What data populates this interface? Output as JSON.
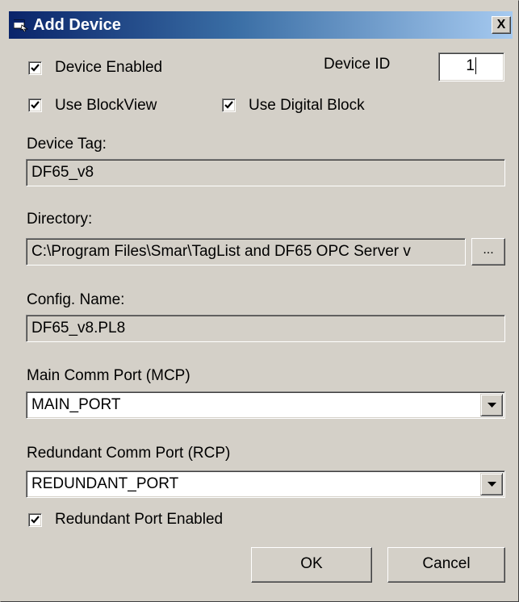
{
  "window": {
    "title": "Add Device",
    "title_icon": "app-window-icon",
    "close_icon": "close-icon",
    "close_label": "X"
  },
  "checkboxes": {
    "device_enabled": {
      "label": "Device Enabled",
      "checked": true
    },
    "use_blockview": {
      "label": "Use BlockView",
      "checked": true
    },
    "use_digital_block": {
      "label": "Use Digital Block",
      "checked": true
    },
    "redundant_port_enabled": {
      "label": "Redundant Port Enabled",
      "checked": true
    }
  },
  "device_id": {
    "label": "Device ID",
    "value": "1"
  },
  "device_tag": {
    "label": "Device Tag:",
    "value": "DF65_v8"
  },
  "directory": {
    "label": "Directory:",
    "value": "C:\\Program Files\\Smar\\TagList and DF65 OPC Server v",
    "browse_label": "..."
  },
  "config_name": {
    "label": "Config. Name:",
    "value": "DF65_v8.PL8"
  },
  "main_comm_port": {
    "label": "Main Comm Port (MCP)",
    "selected": "MAIN_PORT",
    "icon": "dropdown-arrow-icon"
  },
  "redundant_comm_port": {
    "label": "Redundant Comm Port (RCP)",
    "selected": "REDUNDANT_PORT",
    "icon": "dropdown-arrow-icon"
  },
  "buttons": {
    "ok_label": "OK",
    "cancel_label": "Cancel"
  },
  "colors": {
    "title_gradient_start": "#0a246a",
    "title_gradient_end": "#a6caf0",
    "dialog_face": "#d4d0c8"
  }
}
